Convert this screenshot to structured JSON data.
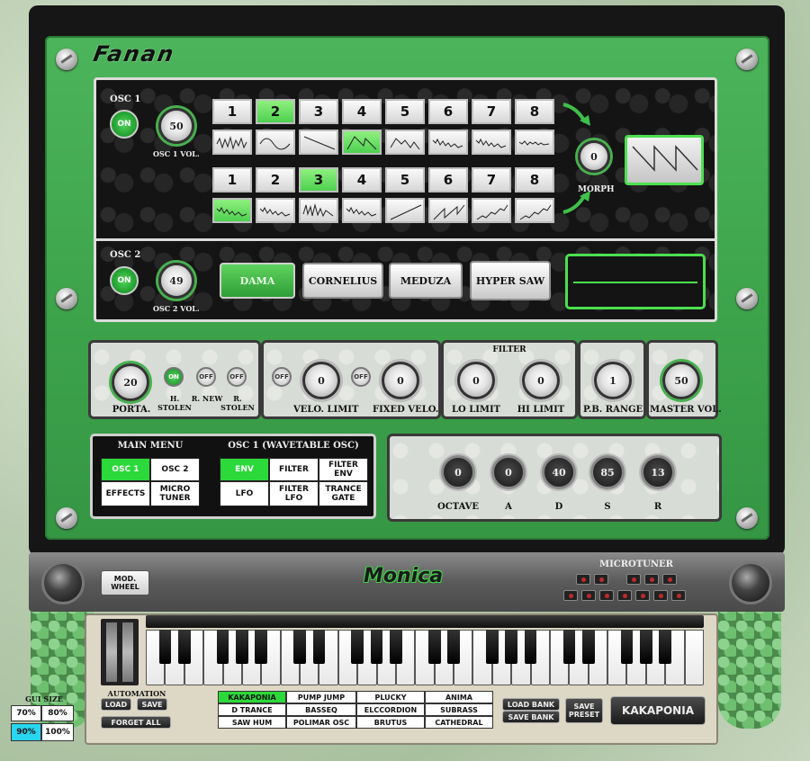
{
  "app": {
    "brand_top": "Fanan",
    "brand_middle": "Monica",
    "accent_color": "#3ea54c",
    "selected_color": "#2bd93a"
  },
  "osc1": {
    "label": "OSC 1",
    "on_label": "ON",
    "vol_value": "50",
    "vol_label": "OSC 1 VOL.",
    "row1_numbers": [
      "1",
      "2",
      "3",
      "4",
      "5",
      "6",
      "7",
      "8"
    ],
    "row1_selected": 1,
    "row1_waves": [
      "noise",
      "sine",
      "ramp-down",
      "saw",
      "saw-noisy",
      "noise-decay",
      "noise-decay",
      "noise-flat"
    ],
    "row1_wave_selected": 3,
    "row2_numbers": [
      "1",
      "2",
      "3",
      "4",
      "5",
      "6",
      "7",
      "8"
    ],
    "row2_selected": 2,
    "row2_waves": [
      "noise-decay",
      "noise-decay",
      "noise-spiky",
      "noise-decay",
      "ramp-up",
      "saw-up",
      "saw-up-noisy",
      "saw-up-noisy"
    ],
    "row2_wave_selected": 0,
    "morph_value": "0",
    "morph_label": "MORPH",
    "display_wave": "saw"
  },
  "osc2": {
    "label": "OSC 2",
    "on_label": "ON",
    "vol_value": "49",
    "vol_label": "OSC 2 VOL.",
    "presets": [
      "DAMA",
      "CORNELIUS",
      "MEDUZA",
      "HYPER SAW"
    ],
    "preset_selected": 0
  },
  "controls": {
    "porta_value": "20",
    "porta_label": "PORTA.",
    "h_stolen_state": "ON",
    "h_stolen_label": "H. STOLEN",
    "r_new_state": "OFF",
    "r_new_label": "R. NEW",
    "r_stolen_state": "OFF",
    "r_stolen_label": "R. STOLEN",
    "velo_toggle": "OFF",
    "velo_limit_value": "0",
    "velo_limit_label": "VELO. LIMIT",
    "fixed_toggle": "OFF",
    "fixed_velo_value": "0",
    "fixed_velo_label": "FIXED VELO.",
    "filter_heading": "FILTER",
    "lo_limit_value": "0",
    "lo_limit_label": "LO LIMIT",
    "hi_limit_value": "0",
    "hi_limit_label": "HI LIMIT",
    "pb_range_value": "1",
    "pb_range_label": "P.B. RANGE",
    "master_vol_value": "50",
    "master_vol_label": "MASTER VOL."
  },
  "main_menu": {
    "heading": "MAIN MENU",
    "items": [
      "OSC 1",
      "OSC 2",
      "EFFECTS",
      "MICRO TUNER"
    ],
    "selected": 0
  },
  "osc_menu": {
    "heading": "OSC 1 (WAVETABLE OSC)",
    "items": [
      "ENV",
      "FILTER",
      "FILTER ENV",
      "LFO",
      "FILTER LFO",
      "TRANCE GATE"
    ],
    "selected": 0
  },
  "adsr": {
    "octave_value": "0",
    "octave_label": "OCTAVE",
    "a_value": "0",
    "a_label": "A",
    "d_value": "40",
    "d_label": "D",
    "s_value": "85",
    "s_label": "S",
    "r_value": "13",
    "r_label": "R"
  },
  "bar": {
    "mod_wheel_label": "MOD. WHEEL",
    "microtuner_label": "MICROTUNER"
  },
  "automation": {
    "heading": "AUTOMATION",
    "load_label": "LOAD",
    "save_label": "SAVE",
    "forget_label": "FORGET ALL"
  },
  "gui_size": {
    "heading": "GUI SIZE",
    "options": [
      "70%",
      "80%",
      "90%",
      "100%"
    ],
    "selected": 2
  },
  "presets": {
    "items": [
      "KAKAPONIA",
      "PUMP JUMP",
      "PLUCKY",
      "ANIMA",
      "D TRANCE",
      "BASSEQ",
      "ELCCORDION",
      "SUBRASS",
      "SAW HUM",
      "POLIMAR OSC",
      "BRUTUS",
      "CATHEDRAL"
    ],
    "selected": 0,
    "load_bank_label": "LOAD BANK",
    "save_bank_label": "SAVE BANK",
    "save_preset_label": "SAVE PRESET",
    "current_preset": "KAKAPONIA"
  }
}
